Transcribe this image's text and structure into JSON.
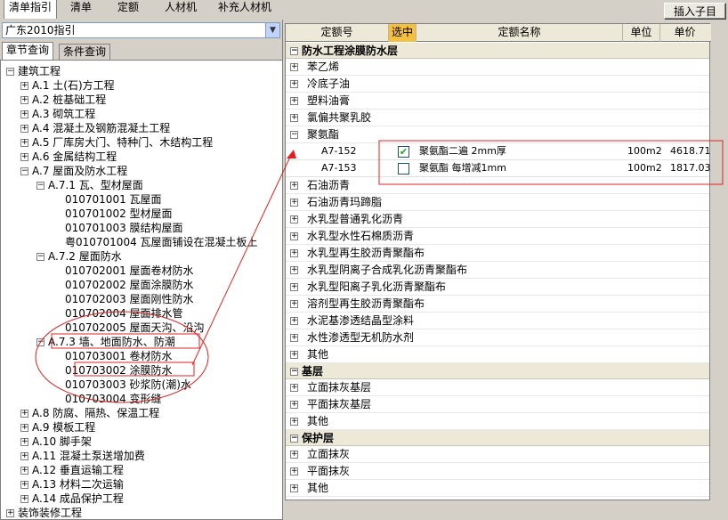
{
  "top_tabs": [
    "清单指引",
    "清单",
    "定额",
    "人材机",
    "补充人材机"
  ],
  "insert_button": "插入子目",
  "guide_select": "广东2010指引",
  "sub_tabs": [
    "章节查询",
    "条件查询"
  ],
  "tree": [
    {
      "label": "建筑工程",
      "expander": "−",
      "level": 0
    },
    {
      "label": "A.1 土(石)方工程",
      "expander": "+",
      "level": 1
    },
    {
      "label": "A.2 桩基础工程",
      "expander": "+",
      "level": 1
    },
    {
      "label": "A.3 砌筑工程",
      "expander": "+",
      "level": 1
    },
    {
      "label": "A.4 混凝土及钢筋混凝土工程",
      "expander": "+",
      "level": 1
    },
    {
      "label": "A.5 厂库房大门、特种门、木结构工程",
      "expander": "+",
      "level": 1
    },
    {
      "label": "A.6 金属结构工程",
      "expander": "+",
      "level": 1
    },
    {
      "label": "A.7 屋面及防水工程",
      "expander": "−",
      "level": 1
    },
    {
      "label": "A.7.1 瓦、型材屋面",
      "expander": "−",
      "level": 2
    },
    {
      "label": "010701001  瓦屋面",
      "expander": "",
      "level": 3
    },
    {
      "label": "010701002  型材屋面",
      "expander": "",
      "level": 3
    },
    {
      "label": "010701003  膜结构屋面",
      "expander": "",
      "level": 3
    },
    {
      "label": "粤010701004  瓦屋面铺设在混凝土板上",
      "expander": "",
      "level": 3
    },
    {
      "label": "A.7.2 屋面防水",
      "expander": "−",
      "level": 2
    },
    {
      "label": "010702001  屋面卷材防水",
      "expander": "",
      "level": 3
    },
    {
      "label": "010702002  屋面涂膜防水",
      "expander": "",
      "level": 3
    },
    {
      "label": "010702003  屋面刚性防水",
      "expander": "",
      "level": 3
    },
    {
      "label": "010702004  屋面排水管",
      "expander": "",
      "level": 3
    },
    {
      "label": "010702005  屋面天沟、沿沟",
      "expander": "",
      "level": 3
    },
    {
      "label": "A.7.3 墙、地面防水、防潮",
      "expander": "−",
      "level": 2
    },
    {
      "label": "010703001  卷材防水",
      "expander": "",
      "level": 3
    },
    {
      "label": "010703002  涂膜防水",
      "expander": "",
      "level": 3
    },
    {
      "label": "010703003  砂浆防(潮)水",
      "expander": "",
      "level": 3
    },
    {
      "label": "010703004  变形缝",
      "expander": "",
      "level": 3
    },
    {
      "label": "A.8 防腐、隔热、保温工程",
      "expander": "+",
      "level": 1
    },
    {
      "label": "A.9 模板工程",
      "expander": "+",
      "level": 1
    },
    {
      "label": "A.10 脚手架",
      "expander": "+",
      "level": 1
    },
    {
      "label": "A.11 混凝土泵送增加费",
      "expander": "+",
      "level": 1
    },
    {
      "label": "A.12 垂直运输工程",
      "expander": "+",
      "level": 1
    },
    {
      "label": "A.13 材料二次运输",
      "expander": "+",
      "level": 1
    },
    {
      "label": "A.14 成品保护工程",
      "expander": "+",
      "level": 1
    },
    {
      "label": "装饰装修工程",
      "expander": "+",
      "level": 0
    }
  ],
  "grid": {
    "headers": [
      "定额号",
      "选中",
      "定额名称",
      "单位",
      "单价"
    ],
    "rows": [
      {
        "kind": "sec",
        "label": "防水工程涂膜防水层",
        "expander": "−"
      },
      {
        "kind": "cat",
        "label": "苯乙烯",
        "expander": "+"
      },
      {
        "kind": "cat",
        "label": "冷底子油",
        "expander": "+"
      },
      {
        "kind": "cat",
        "label": "塑料油膏",
        "expander": "+"
      },
      {
        "kind": "cat",
        "label": "氯偏共聚乳胶",
        "expander": "+"
      },
      {
        "kind": "cat",
        "label": "聚氨酯",
        "expander": "−"
      },
      {
        "kind": "item",
        "code": "A7-152",
        "checked": true,
        "name": "聚氨酯二遍 2mm厚",
        "unit": "100m2",
        "price": "4618.71"
      },
      {
        "kind": "item",
        "code": "A7-153",
        "checked": false,
        "name": "聚氨酯 每增减1mm",
        "unit": "100m2",
        "price": "1817.03"
      },
      {
        "kind": "cat",
        "label": "石油沥青",
        "expander": "+"
      },
      {
        "kind": "cat",
        "label": "石油沥青玛蹄脂",
        "expander": "+"
      },
      {
        "kind": "cat",
        "label": "水乳型普通乳化沥青",
        "expander": "+"
      },
      {
        "kind": "cat",
        "label": "水乳型水性石棉质沥青",
        "expander": "+"
      },
      {
        "kind": "cat",
        "label": "水乳型再生胶沥青聚酯布",
        "expander": "+"
      },
      {
        "kind": "cat",
        "label": "水乳型阴离子合成乳化沥青聚酯布",
        "expander": "+"
      },
      {
        "kind": "cat",
        "label": "水乳型阳离子乳化沥青聚酯布",
        "expander": "+"
      },
      {
        "kind": "cat",
        "label": "溶剂型再生胶沥青聚酯布",
        "expander": "+"
      },
      {
        "kind": "cat",
        "label": "水泥基渗透结晶型涂料",
        "expander": "+"
      },
      {
        "kind": "cat",
        "label": "水性渗透型无机防水剂",
        "expander": "+"
      },
      {
        "kind": "cat",
        "label": "其他",
        "expander": "+"
      },
      {
        "kind": "sec",
        "label": "基层",
        "expander": "−"
      },
      {
        "kind": "cat",
        "label": "立面抹灰基层",
        "expander": "+"
      },
      {
        "kind": "cat",
        "label": "平面抹灰基层",
        "expander": "+"
      },
      {
        "kind": "cat",
        "label": "其他",
        "expander": "+"
      },
      {
        "kind": "sec",
        "label": "保护层",
        "expander": "−"
      },
      {
        "kind": "cat",
        "label": "立面抹灰",
        "expander": "+"
      },
      {
        "kind": "cat",
        "label": "平面抹灰",
        "expander": "+"
      },
      {
        "kind": "cat",
        "label": "其他",
        "expander": "+"
      }
    ]
  },
  "colors": {
    "selected_header": "#f5c03d",
    "annotation": "#e02020",
    "check": "#21a121"
  }
}
